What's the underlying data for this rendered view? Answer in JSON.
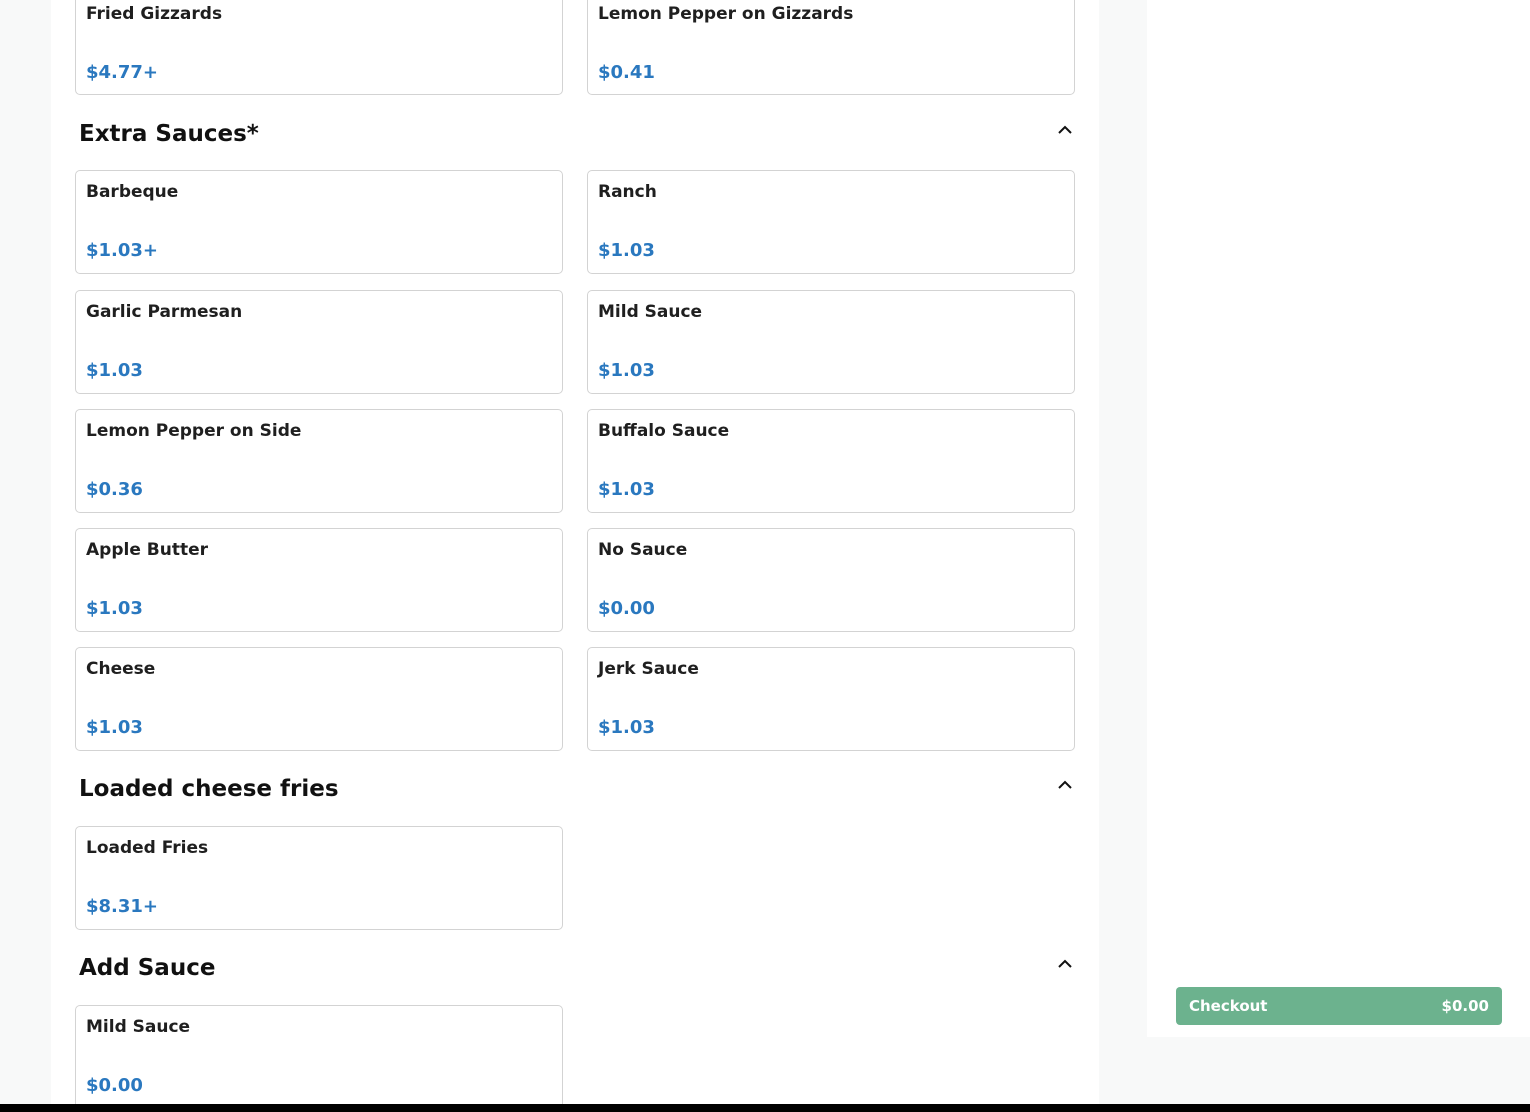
{
  "sections": [
    {
      "items": [
        {
          "name": "Fried Gizzards",
          "price": "$4.77+"
        },
        {
          "name": "Lemon Pepper on Gizzards",
          "price": "$0.41"
        }
      ]
    },
    {
      "title": "Extra Sauces*",
      "chevron_icon": "chevron-up-icon",
      "items": [
        {
          "name": "Barbeque",
          "price": "$1.03+"
        },
        {
          "name": "Ranch",
          "price": "$1.03"
        },
        {
          "name": "Garlic Parmesan",
          "price": "$1.03"
        },
        {
          "name": "Mild Sauce",
          "price": "$1.03"
        },
        {
          "name": "Lemon Pepper on Side",
          "price": "$0.36"
        },
        {
          "name": "Buffalo Sauce",
          "price": "$1.03"
        },
        {
          "name": "Apple Butter",
          "price": "$1.03"
        },
        {
          "name": "No Sauce",
          "price": "$0.00"
        },
        {
          "name": "Cheese",
          "price": "$1.03"
        },
        {
          "name": "Jerk Sauce",
          "price": "$1.03"
        }
      ]
    },
    {
      "title": "Loaded cheese fries",
      "chevron_icon": "chevron-up-icon",
      "items": [
        {
          "name": "Loaded Fries",
          "price": "$8.31+"
        }
      ]
    },
    {
      "title": "Add Sauce",
      "chevron_icon": "chevron-up-icon",
      "items": [
        {
          "name": "Mild Sauce",
          "price": "$0.00"
        }
      ]
    }
  ],
  "checkout": {
    "label": "Checkout",
    "total": "$0.00"
  },
  "colors": {
    "price": "#2a78bf",
    "checkout_bg": "#6cb28e",
    "card_border": "#d3d3d3"
  }
}
